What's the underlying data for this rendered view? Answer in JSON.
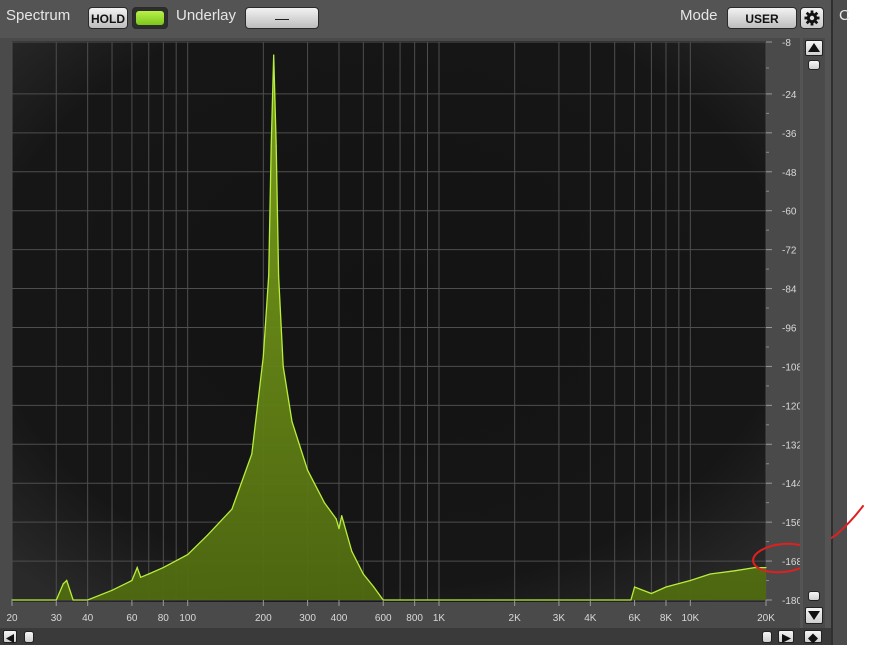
{
  "toolbar": {
    "spectrum_label": "Spectrum",
    "hold_label": "HOLD",
    "underlay_label": "Underlay",
    "underlay_value": "—",
    "mode_label": "Mode",
    "mode_value": "USER"
  },
  "side_panel": {
    "partial_label": "C"
  },
  "colors": {
    "panel_bg": "#545454",
    "plot_bg": "#111111",
    "grid": "#4e4e4e",
    "spectrum_fill": "#5e7d14",
    "spectrum_line": "#b8ee3c",
    "annotation": "#e02020"
  },
  "icons": {
    "gear": "gear-icon",
    "up": "arrow-up-icon",
    "down": "arrow-down-icon",
    "left": "arrow-left-icon",
    "right": "arrow-right-icon",
    "diamond": "diamond-icon"
  },
  "chart_data": {
    "type": "area",
    "xscale": "log",
    "xlim": [
      20,
      20000
    ],
    "ylim": [
      -180,
      -8
    ],
    "x_tick_labels": [
      {
        "value": 20,
        "label": "20"
      },
      {
        "value": 30,
        "label": "30"
      },
      {
        "value": 40,
        "label": "40"
      },
      {
        "value": 60,
        "label": "60"
      },
      {
        "value": 80,
        "label": "80"
      },
      {
        "value": 100,
        "label": "100"
      },
      {
        "value": 200,
        "label": "200"
      },
      {
        "value": 300,
        "label": "300"
      },
      {
        "value": 400,
        "label": "400"
      },
      {
        "value": 600,
        "label": "600"
      },
      {
        "value": 800,
        "label": "800"
      },
      {
        "value": 1000,
        "label": "1K"
      },
      {
        "value": 2000,
        "label": "2K"
      },
      {
        "value": 3000,
        "label": "3K"
      },
      {
        "value": 4000,
        "label": "4K"
      },
      {
        "value": 6000,
        "label": "6K"
      },
      {
        "value": 8000,
        "label": "8K"
      },
      {
        "value": 10000,
        "label": "10K"
      },
      {
        "value": 20000,
        "label": "20K"
      }
    ],
    "y_tick_labels": [
      "-8",
      "-24",
      "-36",
      "-48",
      "-60",
      "-72",
      "-84",
      "-96",
      "-108",
      "-120",
      "-132",
      "-144",
      "-156",
      "-168",
      "-180"
    ],
    "series": [
      {
        "x": [
          20,
          30,
          32,
          33,
          35,
          40,
          50,
          60,
          63,
          65,
          70,
          80,
          100,
          120,
          150,
          180,
          200,
          210,
          215,
          220,
          225,
          230,
          240,
          260,
          300,
          350,
          390,
          400,
          410,
          450,
          500,
          550,
          600,
          5800,
          6000,
          7000,
          8000,
          10000,
          12000,
          15000,
          18000,
          20000
        ],
        "y": [
          -180,
          -180,
          -175,
          -174,
          -180,
          -180,
          -177,
          -174,
          -170,
          -173,
          -172,
          -170,
          -166,
          -160,
          -152,
          -135,
          -105,
          -80,
          -40,
          -12,
          -40,
          -80,
          -108,
          -125,
          -140,
          -150,
          -155,
          -158,
          -154,
          -165,
          -172,
          -176,
          -180,
          -180,
          -176,
          -178,
          -176,
          -174,
          -172,
          -171,
          -170,
          -170
        ]
      }
    ]
  }
}
